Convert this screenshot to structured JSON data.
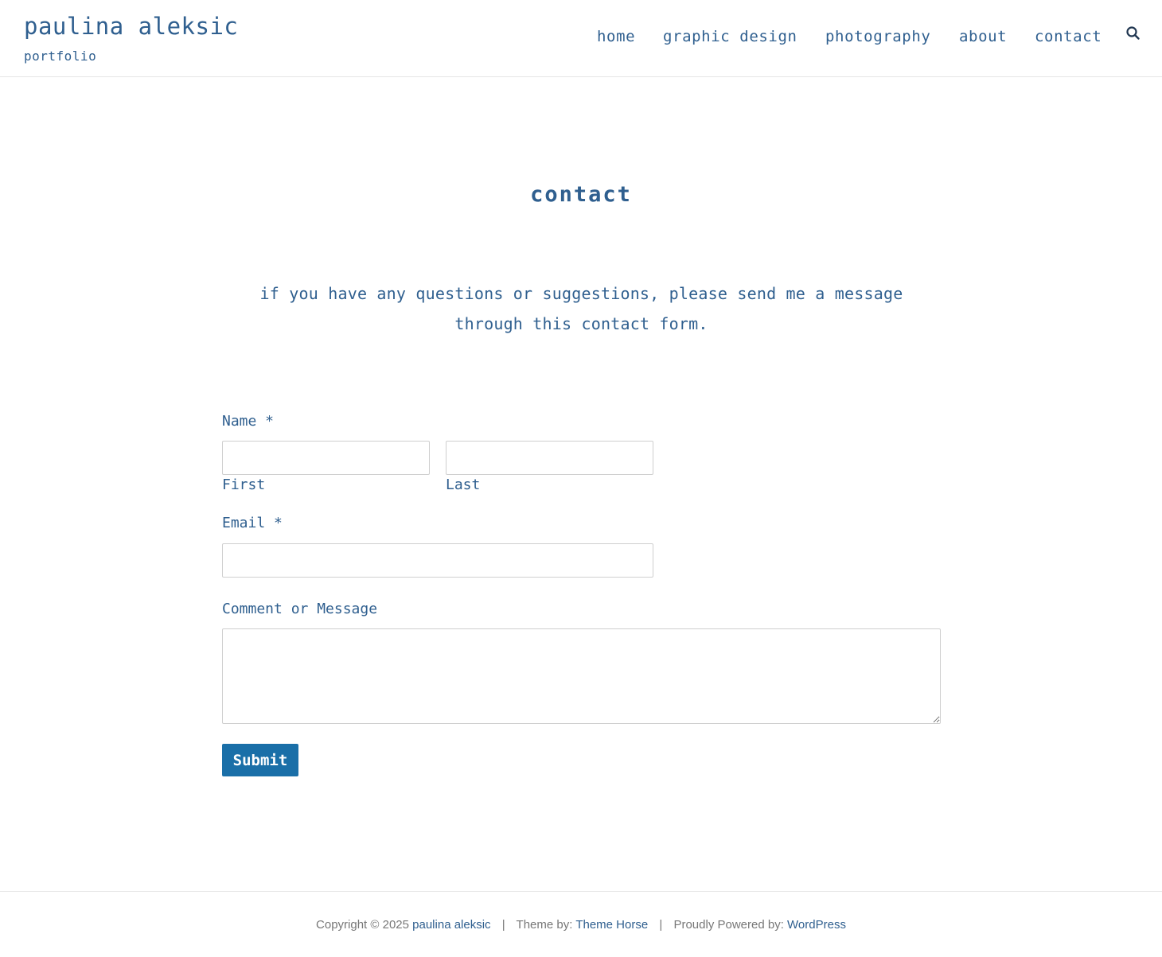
{
  "header": {
    "site_title": "paulina aleksic",
    "tagline": "portfolio",
    "nav": [
      {
        "label": "home"
      },
      {
        "label": "graphic design"
      },
      {
        "label": "photography"
      },
      {
        "label": "about"
      },
      {
        "label": "contact"
      }
    ],
    "search_icon": "search-icon"
  },
  "main": {
    "title": "contact",
    "intro": "if you have any questions or suggestions, please send me a message through this contact form."
  },
  "form": {
    "name_label": "Name *",
    "first_label": "First",
    "last_label": "Last",
    "first_value": "",
    "last_value": "",
    "email_label": "Email *",
    "email_value": "",
    "message_label": "Comment or Message",
    "message_value": "",
    "submit_label": "Submit"
  },
  "footer": {
    "copyright": "Copyright © 2025",
    "site_link": "paulina aleksic",
    "theme_prefix": "Theme by:",
    "theme_link": "Theme Horse",
    "powered_prefix": "Proudly Powered by:",
    "powered_link": "WordPress",
    "separator": "|"
  },
  "colors": {
    "text": "#2f5f8f",
    "button": "#1a6fa8",
    "footer_text": "#777777"
  }
}
